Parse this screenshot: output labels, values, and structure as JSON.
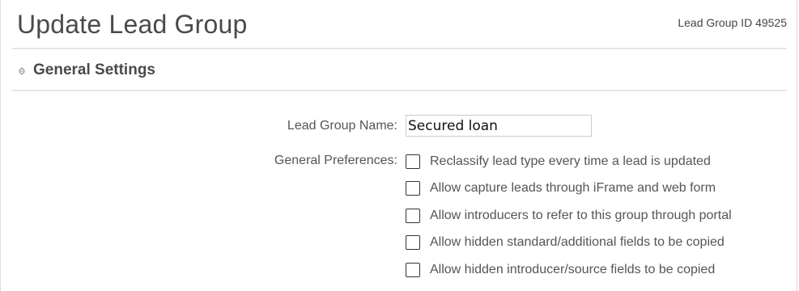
{
  "header": {
    "title": "Update Lead Group",
    "lead_group_id": "Lead Group ID 49525"
  },
  "section": {
    "title": "General Settings",
    "icon": "expand-collapse-icon"
  },
  "form": {
    "name_label": "Lead Group Name:",
    "name_value": "Secured loan",
    "preferences_label": "General Preferences:",
    "preferences": [
      {
        "label": "Reclassify lead type every time a lead is updated",
        "checked": false
      },
      {
        "label": "Allow capture leads through iFrame and web form",
        "checked": false
      },
      {
        "label": "Allow introducers to refer to this group through portal",
        "checked": false
      },
      {
        "label": "Allow hidden standard/additional fields to be copied",
        "checked": false
      },
      {
        "label": "Allow hidden introducer/source fields to be copied",
        "checked": false
      }
    ]
  },
  "colors": {
    "text": "#555555",
    "title": "#4a4a4a",
    "rule": "#e6e6e6",
    "checkbox_border": "#333333"
  }
}
